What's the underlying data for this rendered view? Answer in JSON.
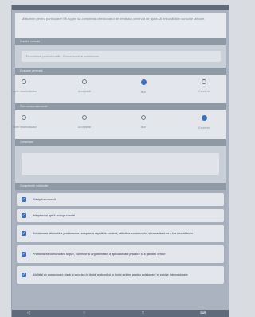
{
  "intro": {
    "text": "Mulțumim pentru participare! Vă rugăm să completați chestionarul de feedback pentru a ne ajuta să îmbunătățim cursurile viitoare."
  },
  "sections": {
    "name_header": "Numele cursului",
    "course_input_value": "Dezvoltare profesională - Comunicare și colaborare",
    "rating1_header": "Evaluare generală",
    "rating2_header": "Relevanța conținutului",
    "comments_header": "Comentarii",
    "skills_header": "Competențe dobândite"
  },
  "rating1": {
    "options": [
      "Foarte nesatisfăcător",
      "Acceptabil",
      "Bun",
      "Excelent"
    ],
    "selected_index": 2
  },
  "rating2": {
    "options": [
      "Foarte nesatisfăcător",
      "Acceptabil",
      "Bun",
      "Excelent"
    ],
    "selected_index": 3
  },
  "checklist": [
    "Disciplina muncii",
    "Adaptare și spirit antreprenorial",
    "Soluționare eficientă a problemelor: adaptarea rapidă la context, atitudine constructivă și capacitate de a lua decizii bune",
    "Promovarea comunicării logice, coerente și argumentate, a aplicabilității practice și a gândirii critice",
    "Abilități de comunicare clară și concisă în limbă maternă și în limbi străine pentru colaborare în echipe internaționale"
  ],
  "colors": {
    "accent": "#3b6fc4",
    "header": "#8f99a6"
  }
}
